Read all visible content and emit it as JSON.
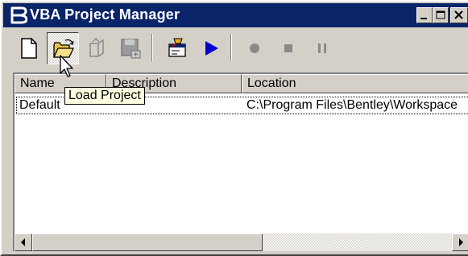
{
  "window": {
    "title": "VBA Project Manager",
    "icon": "bentley-b-icon",
    "controls": [
      "minimize-icon",
      "maximize-icon",
      "close-icon"
    ]
  },
  "toolbar": {
    "buttons": [
      {
        "icon": "new-document-icon",
        "tooltip": "",
        "enabled": true
      },
      {
        "icon": "open-folder-icon",
        "tooltip": "Load Project",
        "enabled": true,
        "pressed": true
      },
      {
        "icon": "unload-project-icon",
        "tooltip": "",
        "enabled": false
      },
      {
        "icon": "save-project-icon",
        "tooltip": "",
        "enabled": false
      },
      {
        "icon": "vba-editor-icon",
        "tooltip": "",
        "enabled": true
      },
      {
        "icon": "run-macro-icon",
        "tooltip": "",
        "enabled": true
      },
      {
        "icon": "record-icon",
        "tooltip": "",
        "enabled": false
      },
      {
        "icon": "stop-icon",
        "tooltip": "",
        "enabled": false
      },
      {
        "icon": "pause-icon",
        "tooltip": "",
        "enabled": false
      }
    ]
  },
  "list": {
    "columns": [
      "Name",
      "Description",
      "Location"
    ],
    "rows": [
      {
        "name": "Default",
        "description": "",
        "location": "C:\\Program Files\\Bentley\\Workspace"
      }
    ]
  },
  "tooltip": {
    "text": "Load Project"
  },
  "colors": {
    "titlebar": "#0a246a",
    "face": "#d4d0c8",
    "tooltip_bg": "#ffffe1",
    "accent_blue": "#0000cc"
  }
}
